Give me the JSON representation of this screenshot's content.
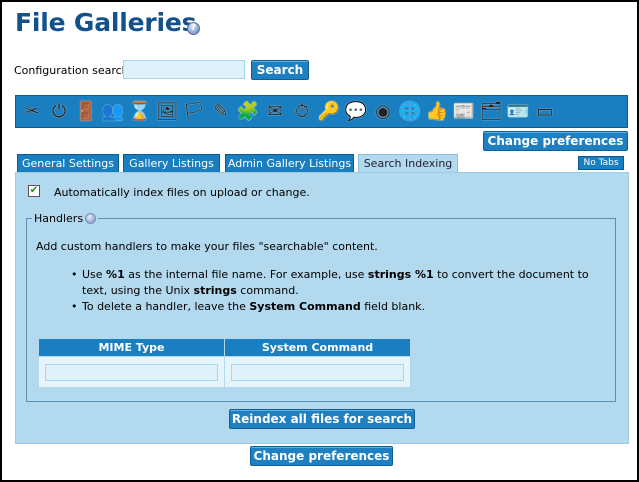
{
  "page": {
    "title": "File Galleries"
  },
  "search": {
    "label": "Configuration search:",
    "value": "",
    "button_label": "Search"
  },
  "toolbar": {
    "icons": [
      "tools-icon",
      "power-icon",
      "login-icon",
      "users-icon",
      "hourglass-icon",
      "image-icon",
      "german-flag-icon",
      "edit-icon",
      "puzzle-icon",
      "mail-icon",
      "clock-icon",
      "keys-icon",
      "chat-bubble-icon",
      "rss-icon",
      "globe-icon",
      "thumbs-up-icon",
      "newspaper-icon",
      "cards-icon",
      "id-card-icon",
      "window-icon"
    ]
  },
  "change_prefs_label": "Change preferences",
  "tabs": [
    {
      "label": "General Settings",
      "active": false
    },
    {
      "label": "Gallery Listings",
      "active": false
    },
    {
      "label": "Admin Gallery Listings",
      "active": false
    },
    {
      "label": "Search Indexing",
      "active": true
    }
  ],
  "no_tabs_label": "No Tabs",
  "indexing": {
    "auto_index_label": "Automatically index files on upload or change.",
    "auto_index_checked": true,
    "handlers": {
      "legend": "Handlers",
      "intro": "Add custom handlers to make your files \"searchable\" content.",
      "bullet1": {
        "pre": "Use ",
        "code1": "%1",
        "mid": " as the internal file name. For example, use ",
        "code2": "strings %1",
        "post": " to convert the document to text, using the Unix ",
        "code3": "strings",
        "end": " command."
      },
      "bullet2": {
        "pre": "To delete a handler, leave the ",
        "code": "System Command",
        "post": " field blank."
      },
      "table": {
        "columns": [
          "MIME Type",
          "System Command"
        ],
        "rows": [
          [
            "",
            ""
          ]
        ]
      }
    },
    "reindex_label": "Reindex all files for search"
  },
  "colors": {
    "title": "#13518b",
    "accent": "#1a7fc0",
    "panel": "#b2d9ee"
  }
}
